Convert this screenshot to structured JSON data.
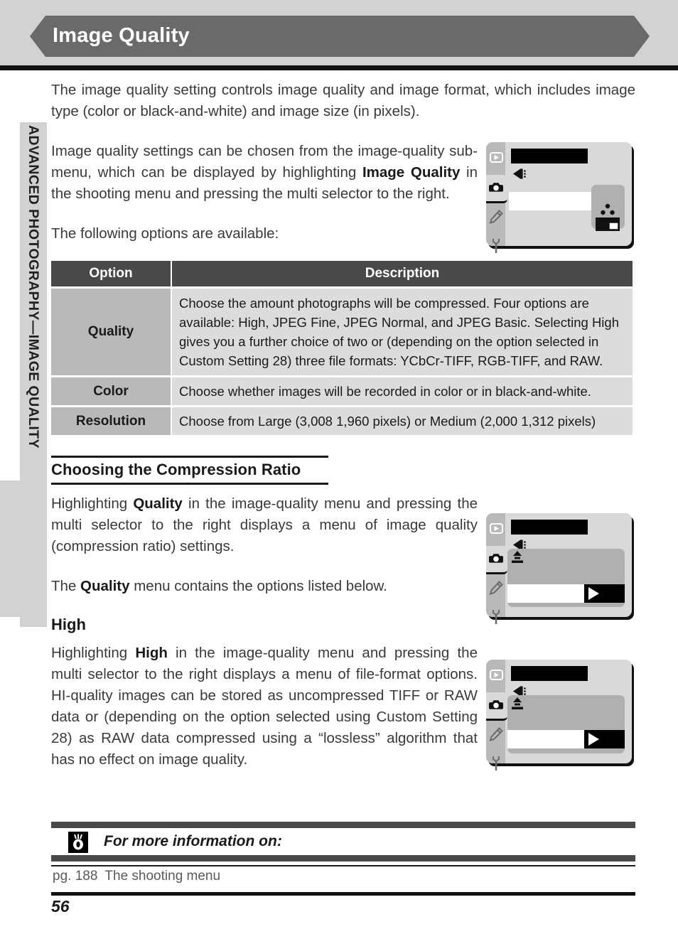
{
  "header": {
    "title": "Image Quality"
  },
  "side_tab": {
    "label": "ADVANCED PHOTOGRAPHY—IMAGE QUALITY"
  },
  "intro": {
    "para1": "The image quality setting controls image quality and image format, which includes image type (color or black-and-white) and image size (in pixels).",
    "para2_a": "Image quality settings can be chosen from the image-quality sub-menu, which can be displayed by highlighting ",
    "para2_b": "Image Quality",
    "para2_c": " in the shooting menu and pressing the multi selector to the right.",
    "para3": "The following options are available:"
  },
  "table": {
    "headers": {
      "option": "Option",
      "description": "Description"
    },
    "rows": [
      {
        "option": "Quality",
        "description": "Choose the amount photographs will be compressed.  Four options are available: High, JPEG Fine, JPEG Normal, and JPEG Basic.  Selecting High gives you a further choice of two or (depending on the option selected in Custom Setting 28) three file formats: YCbCr-TIFF, RGB-TIFF, and RAW."
      },
      {
        "option": "Color",
        "description": "Choose whether images will be recorded in color or in black-and-white."
      },
      {
        "option": "Resolution",
        "description": "Choose from Large (3,008    1,960 pixels) or Medium (2,000    1,312 pixels)"
      }
    ]
  },
  "compression_section": {
    "heading": "Choosing the Compression Ratio",
    "para1_a": "Highlighting ",
    "para1_b": "Quality",
    "para1_c": " in the image-quality menu and pressing the multi selector to the right displays a menu of image quality (compression ratio) settings.",
    "para2_a": "The ",
    "para2_b": "Quality",
    "para2_c": " menu contains the options listed below."
  },
  "high_section": {
    "heading": "High",
    "para_a": "Highlighting ",
    "para_b": "High",
    "para_c": " in the image-quality menu and pressing the multi selector to the right displays a menu of file-format options.  HI-quality images can be stored as uncompressed TIFF or RAW data or (depending on the option selected using Custom Setting 28) as RAW data compressed using a “lossless” algorithm that has no effect on image quality."
  },
  "lcd_screens": [
    {
      "name": "image-quality-submenu"
    },
    {
      "name": "quality-menu"
    },
    {
      "name": "high-file-format-menu"
    }
  ],
  "footer": {
    "icon": "eye-icon",
    "title": "For more information on:",
    "ref_page": "pg. 188",
    "ref_text": "The shooting menu",
    "page_number": "56"
  },
  "colors": {
    "banner_gray": "#6b6a6a",
    "band_gray": "#d2d2d2",
    "table_header": "#4a4949",
    "table_option_cell": "#b9b9b9",
    "table_desc_cell": "#dcdcdc",
    "lcd_body": "#d9d9d9",
    "lcd_sidebar": "#b9b9b9",
    "lcd_panel": "#b0b0b0"
  }
}
